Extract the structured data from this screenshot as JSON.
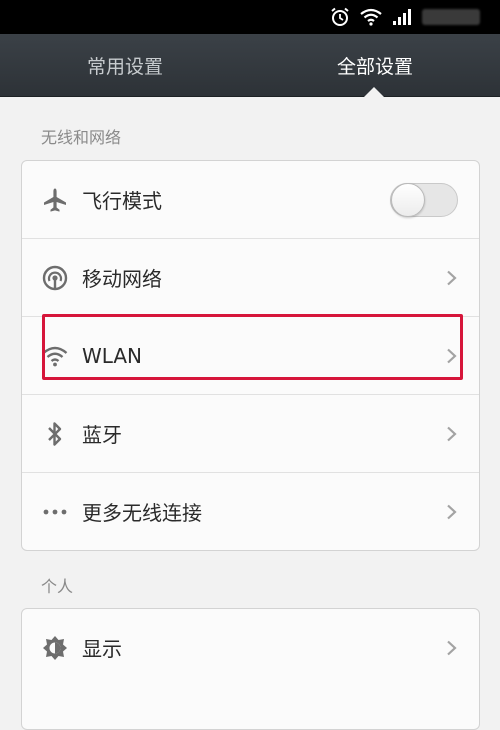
{
  "status_bar": {
    "icons": [
      "alarm-icon",
      "wifi-icon",
      "signal-icon"
    ]
  },
  "tabs": [
    {
      "label": "常用设置",
      "active": false
    },
    {
      "label": "全部设置",
      "active": true
    }
  ],
  "sections": {
    "wireless": {
      "title": "无线和网络",
      "items": [
        {
          "label": "飞行模式",
          "icon": "airplane-icon",
          "control": "toggle",
          "on": false
        },
        {
          "label": "移动网络",
          "icon": "cellular-network-icon",
          "control": "chevron"
        },
        {
          "label": "WLAN",
          "icon": "wifi-icon",
          "control": "chevron",
          "highlighted": true
        },
        {
          "label": "蓝牙",
          "icon": "bluetooth-icon",
          "control": "chevron"
        },
        {
          "label": "更多无线连接",
          "icon": "more-dots-icon",
          "control": "chevron"
        }
      ]
    },
    "personal": {
      "title": "个人",
      "items": [
        {
          "label": "显示",
          "icon": "brightness-icon",
          "control": "chevron"
        }
      ]
    }
  },
  "colors": {
    "tab_bar": "#2f3438",
    "highlight_border": "#d6153a",
    "background": "#f2f2f2"
  }
}
